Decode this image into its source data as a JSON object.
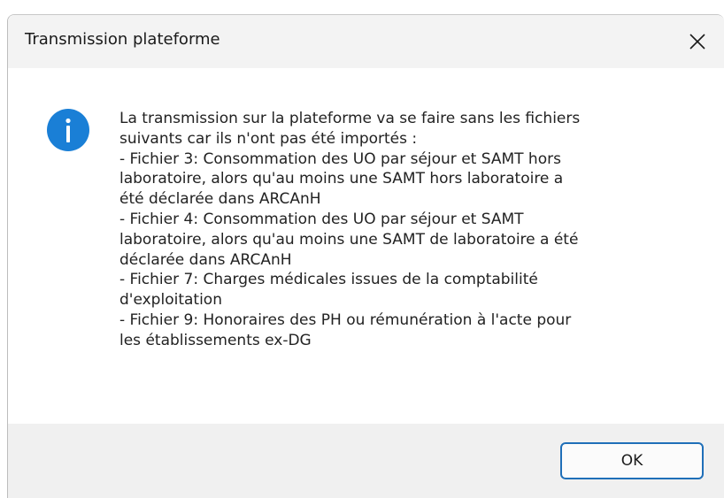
{
  "window": {
    "title": "Transmission plateforme"
  },
  "icons": {
    "close": "close-icon",
    "info": "info-icon"
  },
  "message": {
    "text": "La transmission sur la plateforme va se faire sans les fichiers\nsuivants car ils n'ont pas été importés :\n- Fichier 3: Consommation des UO par séjour et SAMT hors\nlaboratoire, alors qu'au moins une SAMT hors laboratoire a\nété déclarée dans ARCAnH\n- Fichier 4: Consommation des UO par séjour et SAMT\nlaboratoire, alors qu'au moins une SAMT de laboratoire a été\ndéclarée dans ARCAnH\n- Fichier 7: Charges médicales issues de la comptabilité\nd'exploitation\n- Fichier 9: Honoraires des PH ou rémunération à l'acte pour\nles établissements ex-DG"
  },
  "buttons": {
    "ok_label": "OK"
  },
  "colors": {
    "accent": "#1f6fb8",
    "info_icon_fill": "#1a7fd6",
    "titlebar_bg": "#f3f3f3",
    "footer_bg": "#f0f0f0"
  }
}
